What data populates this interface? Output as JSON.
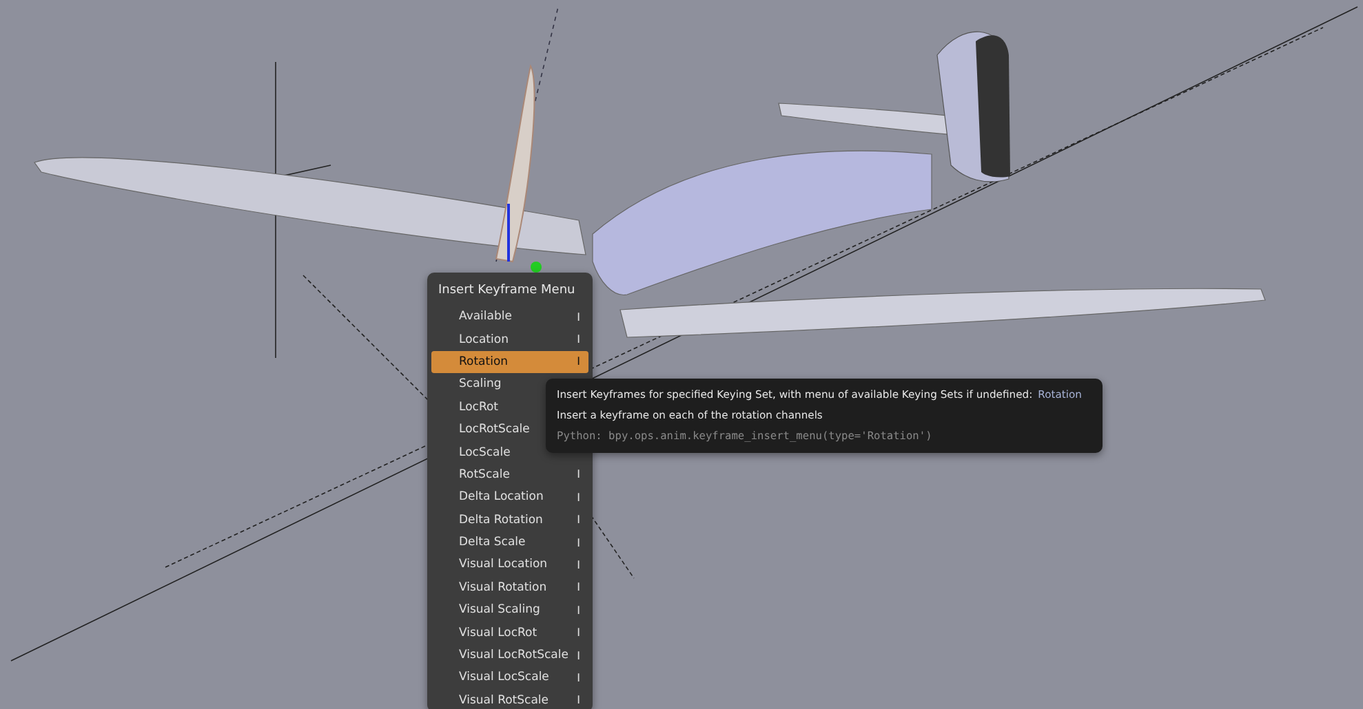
{
  "menu": {
    "title": "Insert Keyframe Menu",
    "items": [
      {
        "label": "Available",
        "shortcut": "I",
        "selected": false
      },
      {
        "label": "Location",
        "shortcut": "I",
        "selected": false
      },
      {
        "label": "Rotation",
        "shortcut": "I",
        "selected": true
      },
      {
        "label": "Scaling",
        "selected": false
      },
      {
        "label": "LocRot",
        "selected": false
      },
      {
        "label": "LocRotScale",
        "selected": false
      },
      {
        "label": "LocScale",
        "selected": false
      },
      {
        "label": "RotScale",
        "shortcut": "I",
        "selected": false
      },
      {
        "label": "Delta Location",
        "shortcut": "I",
        "selected": false
      },
      {
        "label": "Delta Rotation",
        "shortcut": "I",
        "selected": false
      },
      {
        "label": "Delta Scale",
        "shortcut": "I",
        "selected": false
      },
      {
        "label": "Visual Location",
        "shortcut": "I",
        "selected": false
      },
      {
        "label": "Visual Rotation",
        "shortcut": "I",
        "selected": false
      },
      {
        "label": "Visual Scaling",
        "shortcut": "I",
        "selected": false
      },
      {
        "label": "Visual LocRot",
        "shortcut": "I",
        "selected": false
      },
      {
        "label": "Visual LocRotScale",
        "shortcut": "I",
        "selected": false
      },
      {
        "label": "Visual LocScale",
        "shortcut": "I",
        "selected": false
      },
      {
        "label": "Visual RotScale",
        "shortcut": "I",
        "selected": false
      }
    ]
  },
  "tooltip": {
    "description": "Insert Keyframes for specified Keying Set, with menu of available Keying Sets if undefined:",
    "value": "Rotation",
    "detail": "Insert a keyframe on each of the rotation channels",
    "python": "Python: bpy.ops.anim.keyframe_insert_menu(type='Rotation')"
  }
}
